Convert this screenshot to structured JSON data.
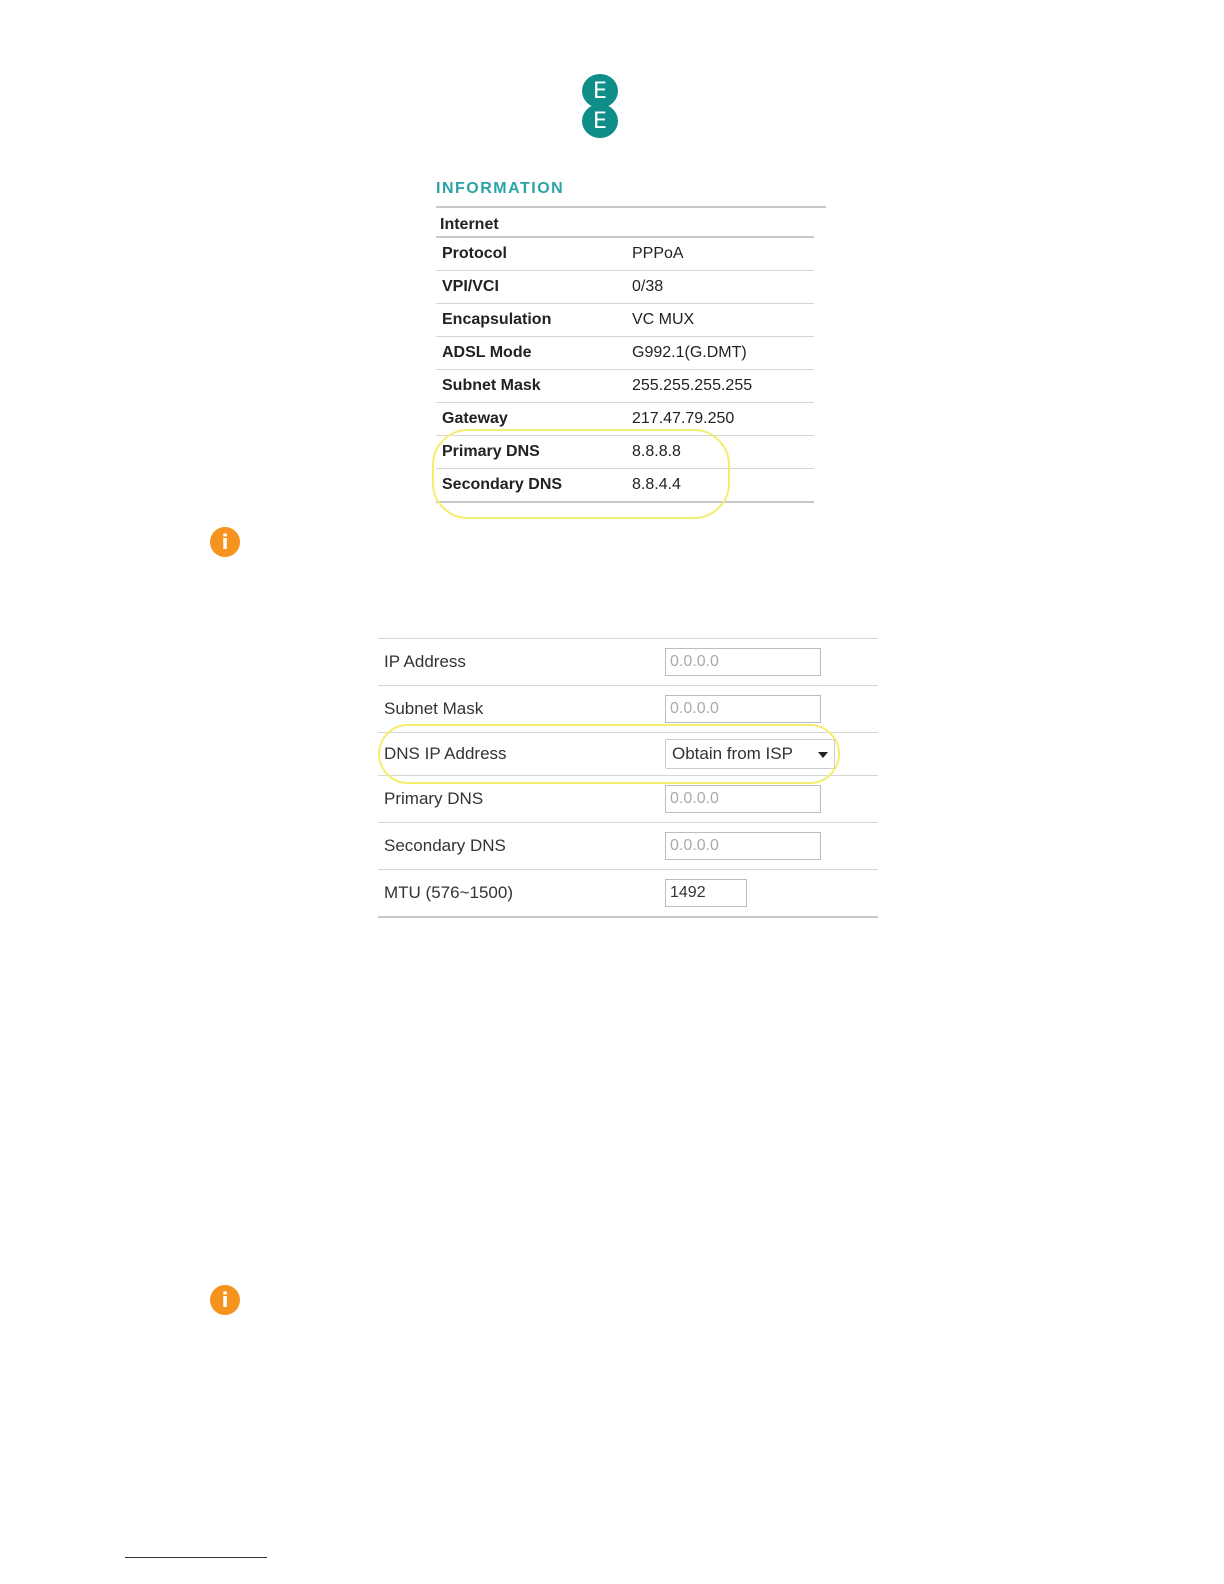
{
  "logo": {
    "letters": [
      "E",
      "E"
    ]
  },
  "information": {
    "title": "INFORMATION",
    "section": "Internet",
    "rows": [
      {
        "key": "Protocol",
        "value": "PPPoA"
      },
      {
        "key": "VPI/VCI",
        "value": "0/38"
      },
      {
        "key": "Encapsulation",
        "value": "VC MUX"
      },
      {
        "key": "ADSL Mode",
        "value": "G992.1(G.DMT)"
      },
      {
        "key": "Subnet Mask",
        "value": "255.255.255.255"
      },
      {
        "key": "Gateway",
        "value": "217.47.79.250"
      },
      {
        "key": "Primary DNS",
        "value": "8.8.8.8"
      },
      {
        "key": "Secondary DNS",
        "value": "8.8.4.4"
      }
    ]
  },
  "info_icon": "i",
  "form": {
    "ip_address": {
      "label": "IP Address",
      "value": "0.0.0.0"
    },
    "subnet_mask": {
      "label": "Subnet Mask",
      "value": "0.0.0.0"
    },
    "dns_ip_address": {
      "label": "DNS IP Address",
      "selected": "Obtain from ISP"
    },
    "primary_dns": {
      "label": "Primary DNS",
      "value": "0.0.0.0"
    },
    "secondary_dns": {
      "label": "Secondary DNS",
      "value": "0.0.0.0"
    },
    "mtu": {
      "label": "MTU (576~1500)",
      "value": "1492"
    }
  },
  "colors": {
    "brand": "#0f8e89",
    "title": "#2aa3a8",
    "highlight": "#f3ee6e",
    "warning": "#f6921e"
  }
}
